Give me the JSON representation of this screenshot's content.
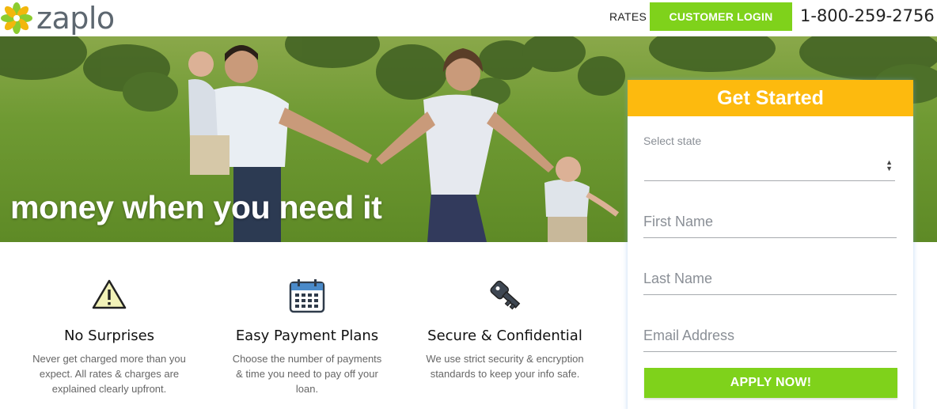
{
  "brand": {
    "name": "zaplo"
  },
  "header": {
    "rates_label": "RATES",
    "login_label": "CUSTOMER LOGIN",
    "phone": "1-800-259-2756"
  },
  "hero": {
    "tagline": "money when you need it"
  },
  "features": [
    {
      "icon": "warning-triangle-icon",
      "title": "No Surprises",
      "text": "Never get charged more than you expect. All rates & charges are explained clearly upfront."
    },
    {
      "icon": "calendar-icon",
      "title": "Easy Payment Plans",
      "text": "Choose the number of payments & time you need to pay off your loan."
    },
    {
      "icon": "key-icon",
      "title": "Secure & Confidential",
      "text": "We use strict security & encryption standards to keep your info safe."
    }
  ],
  "form": {
    "heading": "Get Started",
    "state_label": "Select state",
    "state_value": "",
    "first_name_placeholder": "First Name",
    "last_name_placeholder": "Last Name",
    "email_placeholder": "Email Address",
    "apply_label": "APPLY NOW!"
  },
  "colors": {
    "accent_green": "#7fd21b",
    "header_yellow": "#fdba0e",
    "logo_gray": "#5d6770"
  }
}
